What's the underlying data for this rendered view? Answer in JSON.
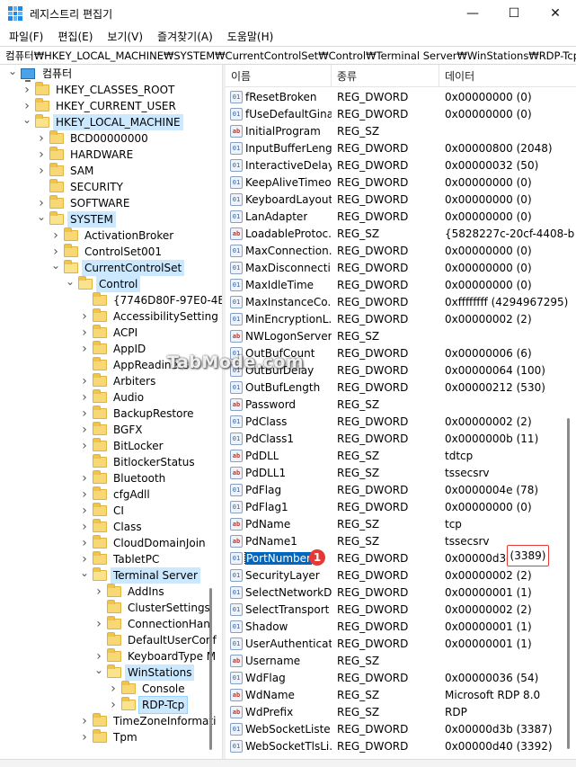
{
  "window": {
    "title": "레지스트리 편집기",
    "controls": {
      "minimize": "—",
      "maximize": "☐",
      "close": "✕"
    }
  },
  "menu": [
    "파일(F)",
    "편집(E)",
    "보기(V)",
    "즐겨찾기(A)",
    "도움말(H)"
  ],
  "address": "컴퓨터₩HKEY_LOCAL_MACHINE₩SYSTEM₩CurrentControlSet₩Control₩Terminal Server₩WinStations₩RDP-Tcp",
  "watermark": "TabMode.com",
  "tree": [
    {
      "label": "컴퓨터",
      "depth": 0,
      "arrow": "v",
      "icon": "pc"
    },
    {
      "label": "HKEY_CLASSES_ROOT",
      "depth": 1,
      "arrow": ">",
      "icon": "folder"
    },
    {
      "label": "HKEY_CURRENT_USER",
      "depth": 1,
      "arrow": ">",
      "icon": "folder"
    },
    {
      "label": "HKEY_LOCAL_MACHINE",
      "depth": 1,
      "arrow": "v",
      "icon": "folder-open",
      "state": "sel"
    },
    {
      "label": "BCD00000000",
      "depth": 2,
      "arrow": ">",
      "icon": "folder"
    },
    {
      "label": "HARDWARE",
      "depth": 2,
      "arrow": ">",
      "icon": "folder"
    },
    {
      "label": "SAM",
      "depth": 2,
      "arrow": ">",
      "icon": "folder"
    },
    {
      "label": "SECURITY",
      "depth": 2,
      "arrow": "",
      "icon": "folder"
    },
    {
      "label": "SOFTWARE",
      "depth": 2,
      "arrow": ">",
      "icon": "folder"
    },
    {
      "label": "SYSTEM",
      "depth": 2,
      "arrow": "v",
      "icon": "folder-open",
      "state": "sel"
    },
    {
      "label": "ActivationBroker",
      "depth": 3,
      "arrow": ">",
      "icon": "folder"
    },
    {
      "label": "ControlSet001",
      "depth": 3,
      "arrow": ">",
      "icon": "folder"
    },
    {
      "label": "CurrentControlSet",
      "depth": 3,
      "arrow": "v",
      "icon": "folder-open",
      "state": "sel"
    },
    {
      "label": "Control",
      "depth": 4,
      "arrow": "v",
      "icon": "folder-open",
      "state": "sel"
    },
    {
      "label": "{7746D80F-97E0-4E",
      "depth": 5,
      "arrow": "",
      "icon": "folder"
    },
    {
      "label": "AccessibilitySetting",
      "depth": 5,
      "arrow": ">",
      "icon": "folder"
    },
    {
      "label": "ACPI",
      "depth": 5,
      "arrow": ">",
      "icon": "folder"
    },
    {
      "label": "AppID",
      "depth": 5,
      "arrow": ">",
      "icon": "folder"
    },
    {
      "label": "AppReadiness",
      "depth": 5,
      "arrow": "",
      "icon": "folder"
    },
    {
      "label": "Arbiters",
      "depth": 5,
      "arrow": ">",
      "icon": "folder"
    },
    {
      "label": "Audio",
      "depth": 5,
      "arrow": ">",
      "icon": "folder"
    },
    {
      "label": "BackupRestore",
      "depth": 5,
      "arrow": ">",
      "icon": "folder"
    },
    {
      "label": "BGFX",
      "depth": 5,
      "arrow": ">",
      "icon": "folder"
    },
    {
      "label": "BitLocker",
      "depth": 5,
      "arrow": ">",
      "icon": "folder"
    },
    {
      "label": "BitlockerStatus",
      "depth": 5,
      "arrow": "",
      "icon": "folder"
    },
    {
      "label": "Bluetooth",
      "depth": 5,
      "arrow": ">",
      "icon": "folder"
    },
    {
      "label": "cfgAdll",
      "depth": 5,
      "arrow": ">",
      "icon": "folder"
    },
    {
      "label": "CI",
      "depth": 5,
      "arrow": ">",
      "icon": "folder"
    },
    {
      "label": "Class",
      "depth": 5,
      "arrow": ">",
      "icon": "folder"
    },
    {
      "label": "CloudDomainJoin",
      "depth": 5,
      "arrow": ">",
      "icon": "folder"
    },
    {
      "label": "TabletPC",
      "depth": 5,
      "arrow": ">",
      "icon": "folder"
    },
    {
      "label": "Terminal Server",
      "depth": 5,
      "arrow": "v",
      "icon": "folder-open",
      "state": "sel"
    },
    {
      "label": "AddIns",
      "depth": 6,
      "arrow": ">",
      "icon": "folder"
    },
    {
      "label": "ClusterSettings",
      "depth": 6,
      "arrow": "",
      "icon": "folder"
    },
    {
      "label": "ConnectionHan",
      "depth": 6,
      "arrow": ">",
      "icon": "folder"
    },
    {
      "label": "DefaultUserConf",
      "depth": 6,
      "arrow": "",
      "icon": "folder"
    },
    {
      "label": "KeyboardType M",
      "depth": 6,
      "arrow": ">",
      "icon": "folder"
    },
    {
      "label": "WinStations",
      "depth": 6,
      "arrow": "v",
      "icon": "folder-open",
      "state": "sel"
    },
    {
      "label": "Console",
      "depth": 7,
      "arrow": ">",
      "icon": "folder"
    },
    {
      "label": "RDP-Tcp",
      "depth": 7,
      "arrow": ">",
      "icon": "folder-open",
      "state": "selfocus"
    },
    {
      "label": "TimeZoneInformati",
      "depth": 5,
      "arrow": ">",
      "icon": "folder"
    },
    {
      "label": "Tpm",
      "depth": 5,
      "arrow": ">",
      "icon": "folder"
    }
  ],
  "list": {
    "headers": [
      "이름",
      "종류",
      "데이터"
    ],
    "rows": [
      {
        "name": "fResetBroken",
        "type": "REG_DWORD",
        "data": "0x00000000 (0)"
      },
      {
        "name": "fUseDefaultGina",
        "type": "REG_DWORD",
        "data": "0x00000000 (0)"
      },
      {
        "name": "InitialProgram",
        "type": "REG_SZ",
        "data": ""
      },
      {
        "name": "InputBufferLeng...",
        "type": "REG_DWORD",
        "data": "0x00000800 (2048)"
      },
      {
        "name": "InteractiveDelay",
        "type": "REG_DWORD",
        "data": "0x00000032 (50)"
      },
      {
        "name": "KeepAliveTimeo...",
        "type": "REG_DWORD",
        "data": "0x00000000 (0)"
      },
      {
        "name": "KeyboardLayout",
        "type": "REG_DWORD",
        "data": "0x00000000 (0)"
      },
      {
        "name": "LanAdapter",
        "type": "REG_DWORD",
        "data": "0x00000000 (0)"
      },
      {
        "name": "LoadableProtoc...",
        "type": "REG_SZ",
        "data": "{5828227c-20cf-4408-b"
      },
      {
        "name": "MaxConnection...",
        "type": "REG_DWORD",
        "data": "0x00000000 (0)"
      },
      {
        "name": "MaxDisconnecti...",
        "type": "REG_DWORD",
        "data": "0x00000000 (0)"
      },
      {
        "name": "MaxIdleTime",
        "type": "REG_DWORD",
        "data": "0x00000000 (0)"
      },
      {
        "name": "MaxInstanceCo...",
        "type": "REG_DWORD",
        "data": "0xffffffff (4294967295)"
      },
      {
        "name": "MinEncryptionL...",
        "type": "REG_DWORD",
        "data": "0x00000002 (2)"
      },
      {
        "name": "NWLogonServer",
        "type": "REG_SZ",
        "data": ""
      },
      {
        "name": "OutBufCount",
        "type": "REG_DWORD",
        "data": "0x00000006 (6)"
      },
      {
        "name": "OutBufDelay",
        "type": "REG_DWORD",
        "data": "0x00000064 (100)"
      },
      {
        "name": "OutBufLength",
        "type": "REG_DWORD",
        "data": "0x00000212 (530)"
      },
      {
        "name": "Password",
        "type": "REG_SZ",
        "data": ""
      },
      {
        "name": "PdClass",
        "type": "REG_DWORD",
        "data": "0x00000002 (2)"
      },
      {
        "name": "PdClass1",
        "type": "REG_DWORD",
        "data": "0x0000000b (11)"
      },
      {
        "name": "PdDLL",
        "type": "REG_SZ",
        "data": "tdtcp"
      },
      {
        "name": "PdDLL1",
        "type": "REG_SZ",
        "data": "tssecsrv"
      },
      {
        "name": "PdFlag",
        "type": "REG_DWORD",
        "data": "0x0000004e (78)"
      },
      {
        "name": "PdFlag1",
        "type": "REG_DWORD",
        "data": "0x00000000 (0)"
      },
      {
        "name": "PdName",
        "type": "REG_SZ",
        "data": "tcp"
      },
      {
        "name": "PdName1",
        "type": "REG_SZ",
        "data": "tssecsrv"
      },
      {
        "name": "PortNumber",
        "type": "REG_DWORD",
        "data": "0x00000d3d",
        "selected": true
      },
      {
        "name": "SecurityLayer",
        "type": "REG_DWORD",
        "data": "0x00000002 (2)"
      },
      {
        "name": "SelectNetworkD...",
        "type": "REG_DWORD",
        "data": "0x00000001 (1)"
      },
      {
        "name": "SelectTransport",
        "type": "REG_DWORD",
        "data": "0x00000002 (2)"
      },
      {
        "name": "Shadow",
        "type": "REG_DWORD",
        "data": "0x00000001 (1)"
      },
      {
        "name": "UserAuthenticat...",
        "type": "REG_DWORD",
        "data": "0x00000001 (1)"
      },
      {
        "name": "Username",
        "type": "REG_SZ",
        "data": ""
      },
      {
        "name": "WdFlag",
        "type": "REG_DWORD",
        "data": "0x00000036 (54)"
      },
      {
        "name": "WdName",
        "type": "REG_SZ",
        "data": "Microsoft RDP 8.0"
      },
      {
        "name": "WdPrefix",
        "type": "REG_SZ",
        "data": "RDP"
      },
      {
        "name": "WebSocketListe...",
        "type": "REG_DWORD",
        "data": "0x00000d3b (3387)"
      },
      {
        "name": "WebSocketTlsLi...",
        "type": "REG_DWORD",
        "data": "0x00000d40 (3392)"
      }
    ]
  },
  "annotation": {
    "badge": "1",
    "highlight": "(3389)"
  },
  "icon_names": {
    "dword": "binary-value-icon",
    "sz": "string-value-icon"
  },
  "colors": {
    "selection": "#0067c0",
    "tree_selection": "#cce8ff",
    "annotation": "#e53935"
  }
}
